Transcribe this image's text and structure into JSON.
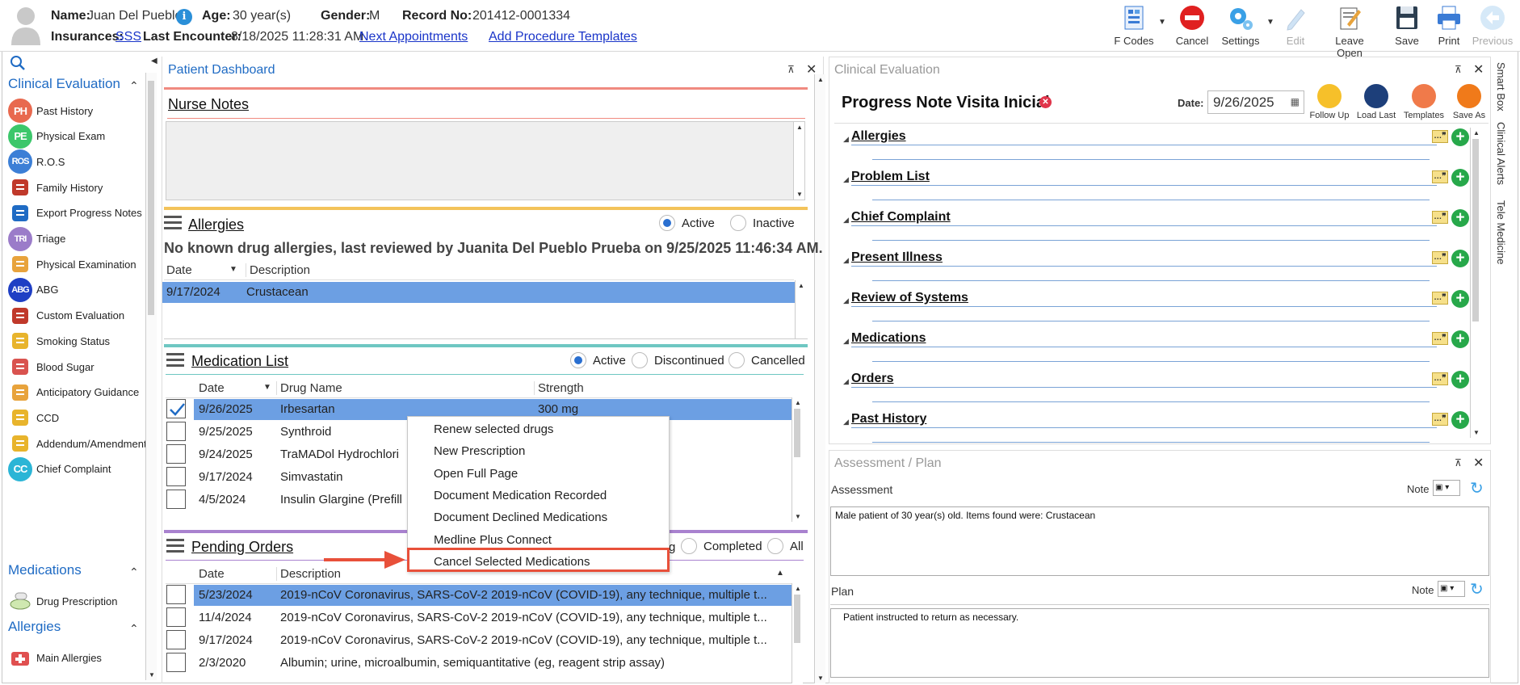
{
  "header": {
    "name_label": "Name:",
    "name_value": "Juan Del Pueblo",
    "age_label": "Age:",
    "age_value": "30 year(s)",
    "gender_label": "Gender:",
    "gender_value": "M",
    "record_label": "Record No:",
    "record_value": "201412-0001334",
    "insurances_label": "Insurances:",
    "insurance_link": "SSS",
    "last_encounter_label": "Last Encounter:",
    "last_encounter_value": "8/18/2025 11:28:31 AM",
    "next_appointments": "Next Appointments",
    "add_procedure_templates": "Add Procedure Templates"
  },
  "toolbar": {
    "fcodes": "F Codes",
    "cancel": "Cancel",
    "settings": "Settings",
    "edit": "Edit",
    "leave_open": "Leave Open",
    "save": "Save",
    "print": "Print",
    "previous": "Previous"
  },
  "sidebar": {
    "clinical_evaluation": "Clinical Evaluation",
    "items": [
      {
        "abbr": "PH",
        "label": "Past History",
        "color": "#e8694f"
      },
      {
        "abbr": "PE",
        "label": "Physical Exam",
        "color": "#3cc76b"
      },
      {
        "abbr": "ROS",
        "label": "R.O.S",
        "color": "#3c7fd6"
      },
      {
        "abbr": "",
        "label": "Family History",
        "color": "#c0392b"
      },
      {
        "abbr": "",
        "label": "Export Progress Notes",
        "color": "#1f6bc4"
      },
      {
        "abbr": "TRI",
        "label": "Triage",
        "color": "#9b7cc9"
      },
      {
        "abbr": "",
        "label": "Physical Examination",
        "color": "#e8a33c"
      },
      {
        "abbr": "ABG",
        "label": "ABG",
        "color": "#1f3fc4"
      },
      {
        "abbr": "",
        "label": "Custom Evaluation",
        "color": "#c0392b"
      },
      {
        "abbr": "",
        "label": "Smoking Status",
        "color": "#e8b42c"
      },
      {
        "abbr": "",
        "label": "Blood Sugar",
        "color": "#d9534f"
      },
      {
        "abbr": "",
        "label": "Anticipatory Guidance",
        "color": "#e8a33c"
      },
      {
        "abbr": "",
        "label": "CCD",
        "color": "#e8b42c"
      },
      {
        "abbr": "",
        "label": "Addendum/Amendments",
        "color": "#e8b42c"
      },
      {
        "abbr": "CC",
        "label": "Chief Complaint",
        "color": "#2bb5d6"
      }
    ],
    "medications": "Medications",
    "drug_prescription": "Drug Prescription",
    "allergies": "Allergies",
    "main_allergies": "Main Allergies"
  },
  "dashboard": {
    "title": "Patient Dashboard",
    "nurse_notes": "Nurse Notes",
    "allergies_title": "Allergies",
    "allergy_active": "Active",
    "allergy_inactive": "Inactive",
    "allergy_summary": "No known drug allergies, last reviewed by Juanita Del Pueblo Prueba on 9/25/2025 11:46:34 AM.",
    "allergy_cols": [
      "Date",
      "Description"
    ],
    "allergy_rows": [
      {
        "date": "9/17/2024",
        "description": "Crustacean"
      }
    ],
    "medlist_title": "Medication List",
    "med_active": "Active",
    "med_discontinued": "Discontinued",
    "med_cancelled": "Cancelled",
    "med_cols": [
      "Date",
      "Drug Name",
      "Strength"
    ],
    "med_rows": [
      {
        "date": "9/26/2025",
        "drug": "Irbesartan",
        "strength": "300 mg",
        "checked": true
      },
      {
        "date": "9/25/2025",
        "drug": "Synthroid",
        "strength": "",
        "checked": false
      },
      {
        "date": "9/24/2025",
        "drug": "TraMADol Hydrochlori",
        "strength": "",
        "checked": false
      },
      {
        "date": "9/17/2024",
        "drug": "Simvastatin",
        "strength": "",
        "checked": false
      },
      {
        "date": "4/5/2024",
        "drug": "Insulin Glargine (Prefill",
        "strength": "",
        "checked": false
      }
    ],
    "pending_title": "Pending Orders",
    "pending_pending_partial": "g",
    "pending_completed": "Completed",
    "pending_all": "All",
    "pending_cols": [
      "Date",
      "Description"
    ],
    "pending_rows": [
      {
        "date": "5/23/2024",
        "description": "2019-nCoV Coronavirus, SARS-CoV-2 2019-nCoV (COVID-19), any technique, multiple t..."
      },
      {
        "date": "11/4/2024",
        "description": "2019-nCoV Coronavirus, SARS-CoV-2 2019-nCoV (COVID-19), any technique, multiple t..."
      },
      {
        "date": "9/17/2024",
        "description": "2019-nCoV Coronavirus, SARS-CoV-2 2019-nCoV (COVID-19), any technique, multiple t..."
      },
      {
        "date": "2/3/2020",
        "description": "Albumin; urine, microalbumin, semiquantitative (eg, reagent strip assay)"
      }
    ]
  },
  "context_menu": {
    "items": [
      "Renew selected drugs",
      "New Prescription",
      "Open Full Page",
      "Document Medication Recorded",
      "Document Declined Medications",
      "Medline Plus Connect",
      "Cancel Selected Medications"
    ],
    "highlighted": "Cancel Selected Medications"
  },
  "clinical_eval": {
    "title": "Clinical Evaluation",
    "note_title": "Progress Note Visita Inicial",
    "date_label": "Date:",
    "date_value": "9/26/2025",
    "tools": [
      "Follow Up",
      "Load Last",
      "Templates",
      "Save As"
    ],
    "sections": [
      "Allergies",
      "Problem List",
      "Chief Complaint",
      "Present Illness",
      "Review of Systems",
      "Medications",
      "Orders",
      "Past History"
    ]
  },
  "assessment_plan": {
    "title": "Assessment / Plan",
    "assessment_label": "Assessment",
    "note_label": "Note",
    "assessment_text": "Male patient of 30 year(s) old. Items found were:  Crustacean",
    "plan_label": "Plan",
    "plan_text": "Patient instructed to return as necessary."
  },
  "side_tabs": [
    "Smart Box",
    "Clinical Alerts",
    "Tele Medicine"
  ],
  "colors": {
    "accent": "#1f6bc4",
    "selected_row": "#6c9fe3",
    "callout": "#e8503a"
  }
}
